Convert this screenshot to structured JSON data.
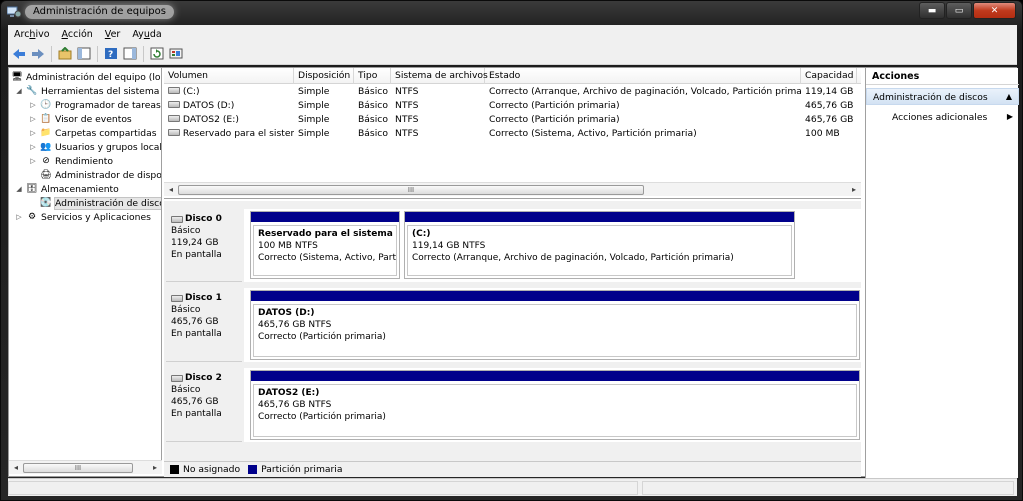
{
  "window": {
    "title": "Administración de equipos"
  },
  "menu": {
    "archivo": {
      "pre": "Arc",
      "key": "h",
      "post": "ivo"
    },
    "accion": {
      "pre": "",
      "key": "A",
      "post": "cción"
    },
    "ver": {
      "pre": "",
      "key": "V",
      "post": "er"
    },
    "ayuda": {
      "pre": "Ay",
      "key": "u",
      "post": "da"
    }
  },
  "toolbar": {
    "icons": [
      "back-icon",
      "forward-icon",
      "up-folder-icon",
      "show-hide-tree-icon",
      "help-icon",
      "show-action-pane-icon",
      "refresh-icon",
      "properties-icon"
    ]
  },
  "tree": {
    "root": "Administración del equipo (loc",
    "tools": "Herramientas del sistema",
    "scheduler": "Programador de tareas",
    "events": "Visor de eventos",
    "shared": "Carpetas compartidas",
    "users": "Usuarios y grupos locale",
    "performance": "Rendimiento",
    "devices": "Administrador de dispo",
    "storage": "Almacenamiento",
    "diskmgmt": "Administración de disco",
    "services": "Servicios y Aplicaciones"
  },
  "volumes": {
    "columns": [
      "Volumen",
      "Disposición",
      "Tipo",
      "Sistema de archivos",
      "Estado",
      "Capacidad"
    ],
    "rows": [
      [
        "(C:)",
        "Simple",
        "Básico",
        "NTFS",
        "Correcto (Arranque, Archivo de paginación, Volcado, Partición primaria)",
        "119,14 GB"
      ],
      [
        "DATOS (D:)",
        "Simple",
        "Básico",
        "NTFS",
        "Correcto (Partición primaria)",
        "465,76 GB"
      ],
      [
        "DATOS2 (E:)",
        "Simple",
        "Básico",
        "NTFS",
        "Correcto (Partición primaria)",
        "465,76 GB"
      ],
      [
        "Reservado para el sistema",
        "Simple",
        "Básico",
        "NTFS",
        "Correcto (Sistema, Activo, Partición primaria)",
        "100 MB"
      ]
    ],
    "scroll_grip": "III"
  },
  "disks": [
    {
      "name": "Disco 0",
      "type": "Básico",
      "size": "119,24 GB",
      "state": "En pantalla",
      "partitions": [
        {
          "title": "Reservado para el sistema",
          "info": "100 MB NTFS",
          "status": "Correcto (Sistema, Activo, Partici"
        },
        {
          "title": "(C:)",
          "info": "119,14 GB NTFS",
          "status": "Correcto (Arranque, Archivo de paginación, Volcado, Partición primaria)"
        }
      ]
    },
    {
      "name": "Disco 1",
      "type": "Básico",
      "size": "465,76 GB",
      "state": "En pantalla",
      "partitions": [
        {
          "title": "DATOS  (D:)",
          "info": "465,76 GB NTFS",
          "status": "Correcto (Partición primaria)"
        }
      ]
    },
    {
      "name": "Disco 2",
      "type": "Básico",
      "size": "465,76 GB",
      "state": "En pantalla",
      "partitions": [
        {
          "title": "DATOS2  (E:)",
          "info": "465,76 GB NTFS",
          "status": "Correcto (Partición primaria)"
        }
      ]
    }
  ],
  "legend": {
    "unallocated": "No asignado",
    "primary": "Partición primaria",
    "unallocated_color": "#000000",
    "primary_color": "#00008b"
  },
  "actions": {
    "header": "Acciones",
    "section": "Administración de discos",
    "more": "Acciones adicionales"
  },
  "tree_scroll_grip": "III"
}
